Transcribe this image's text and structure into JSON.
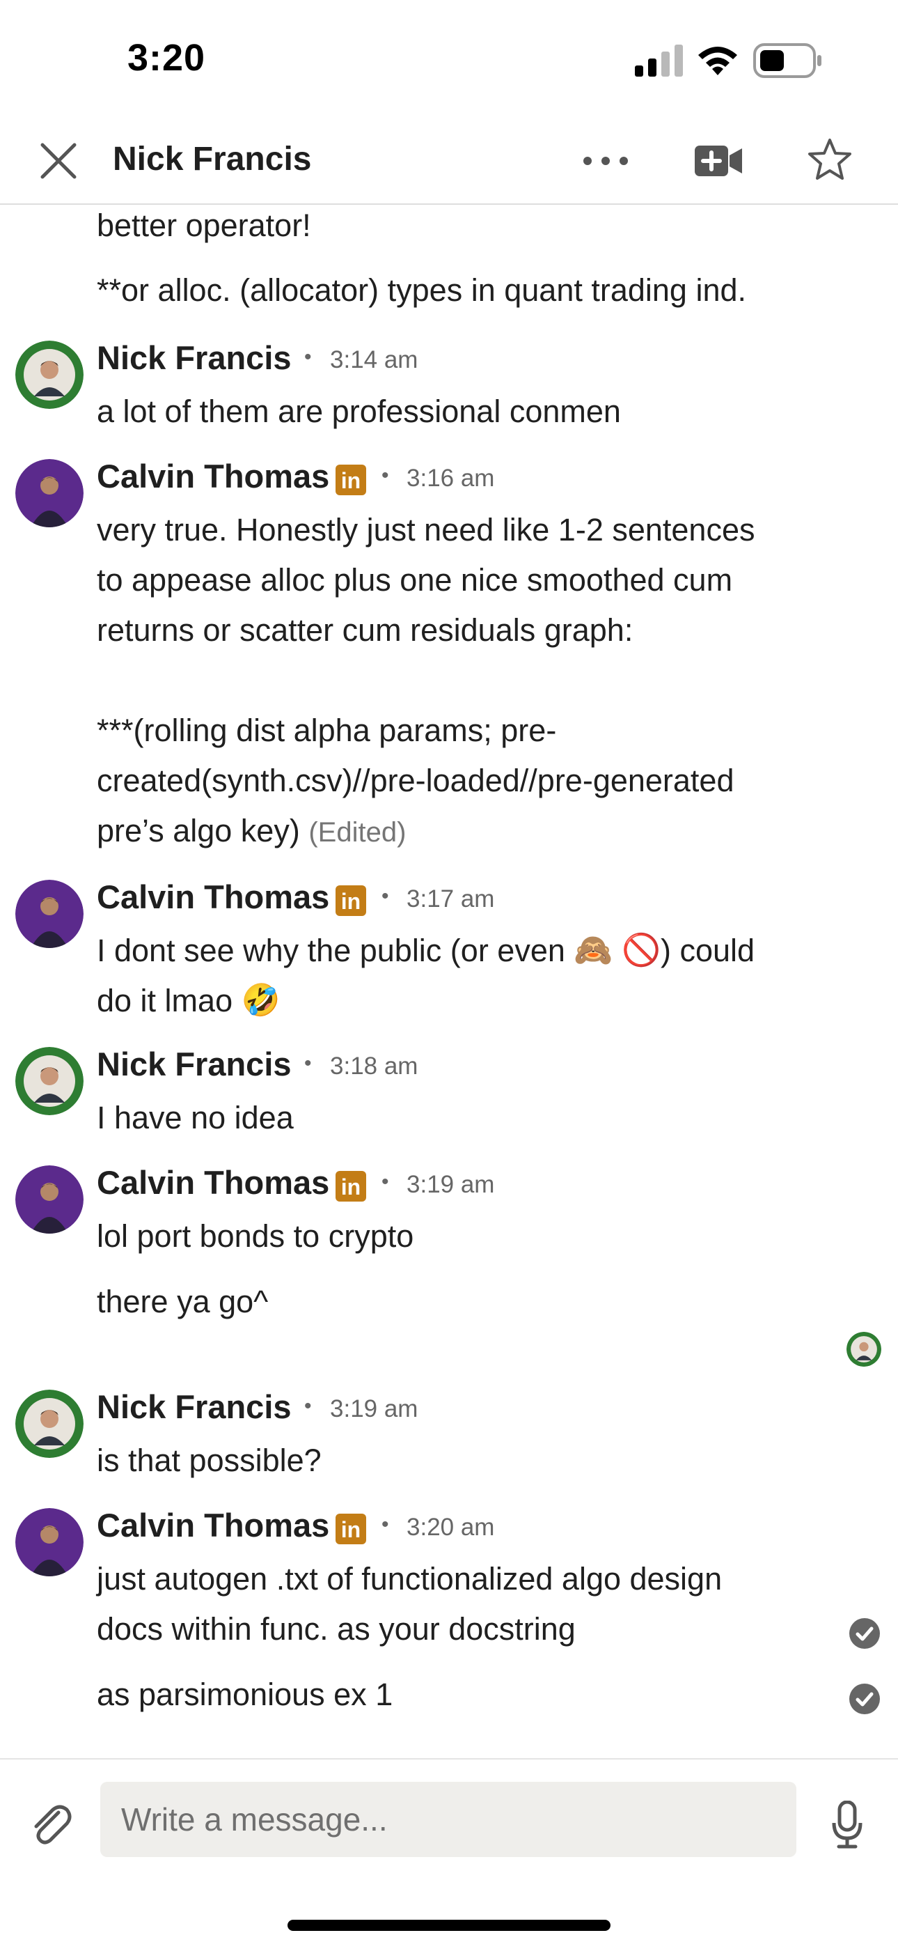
{
  "status_bar": {
    "time": "3:20",
    "signal_icon": "cellular-signal-icon",
    "wifi_icon": "wifi-icon",
    "battery_icon": "battery-icon"
  },
  "header": {
    "title": "Nick Francis",
    "close_icon": "close-icon",
    "more_icon": "more-options-icon",
    "video_icon": "video-call-icon",
    "star_icon": "star-icon"
  },
  "messages": [
    {
      "text": "better operator!"
    },
    {
      "text": "**or alloc. (allocator) types in quant trading ind."
    },
    {
      "sender": "Nick Francis",
      "time": "3:14 am",
      "lines": [
        "a lot of them are professional conmen"
      ]
    },
    {
      "sender": "Calvin Thomas",
      "badge": "in",
      "time": "3:16 am",
      "lines": [
        "very true. Honestly just need like 1-2 sentences",
        "to appease alloc plus one nice smoothed cum",
        "returns or scatter cum residuals graph:",
        "***(rolling dist alpha params; pre-",
        "created(synth.csv)//pre-loaded//pre-generated",
        "pre’s algo key)"
      ],
      "edited": "(Edited)"
    },
    {
      "sender": "Calvin Thomas",
      "badge": "in",
      "time": "3:17 am",
      "line1_a": "I dont see why the public (or even ",
      "line1_emojis": "🙈 🚫",
      "line1_b": ") could",
      "line2_a": "do it lmao ",
      "line2_emoji": "🤣"
    },
    {
      "sender": "Nick Francis",
      "time": "3:18 am",
      "lines": [
        "I have no idea"
      ]
    },
    {
      "sender": "Calvin Thomas",
      "badge": "in",
      "time": "3:19 am",
      "lines": [
        "lol port bonds to crypto",
        "there ya go^"
      ]
    },
    {
      "sender": "Nick Francis",
      "time": "3:19 am",
      "lines": [
        "is that possible?"
      ]
    },
    {
      "sender": "Calvin Thomas",
      "badge": "in",
      "time": "3:20 am",
      "lines": [
        "just autogen .txt of functionalized algo design",
        "docs within func. as your docstring",
        "as parsimonious ex 1"
      ]
    }
  ],
  "composer": {
    "placeholder": "Write a message...",
    "attach_icon": "paperclip-icon",
    "mic_icon": "microphone-icon"
  },
  "colors": {
    "linkedin_badge": "#c37d16",
    "text": "#1f1f1f",
    "meta": "#666666",
    "input_bg": "#efeeeb",
    "nick_avatar_ring": "#2e7d32",
    "calvin_avatar_bg": "#5b2a8c"
  }
}
